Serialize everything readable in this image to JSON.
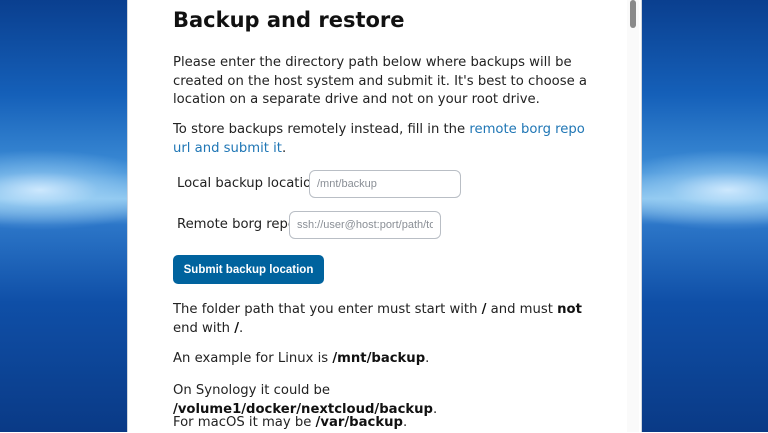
{
  "page": {
    "title": "Backup and restore",
    "intro_text": "Please enter the directory path below where backups will be created on the host system and submit it. It's best to choose a location on a separate drive and not on your root drive.",
    "remote_text_before": "To store backups remotely instead, fill in the ",
    "remote_link": "remote borg repo url and submit it",
    "remote_text_after": "."
  },
  "form": {
    "local_label": "Local backup location",
    "local_placeholder": "/mnt/backup",
    "remote_label": "Remote borg repo",
    "remote_placeholder": "ssh://user@host:port/path/to/repo",
    "submit_label": "Submit backup location"
  },
  "notes": {
    "path_rule_1": "The folder path that you enter must start with ",
    "slash_1": "/",
    "path_rule_2": " and must ",
    "not_word": "not",
    "path_rule_3": " end with ",
    "slash_2": "/",
    "path_rule_4": ".",
    "linux_prefix": "An example for Linux is ",
    "linux_path": "/mnt/backup",
    "linux_suffix": ".",
    "synology_prefix": "On Synology it could be ",
    "synology_path": "/volume1/docker/nextcloud/backup",
    "synology_suffix": ".",
    "macos_prefix": "For macOS it may be ",
    "macos_path": "/var/backup",
    "macos_suffix": "."
  },
  "colors": {
    "button": "#00639e",
    "link": "#1f76b5",
    "desktop": "#1560b9"
  }
}
